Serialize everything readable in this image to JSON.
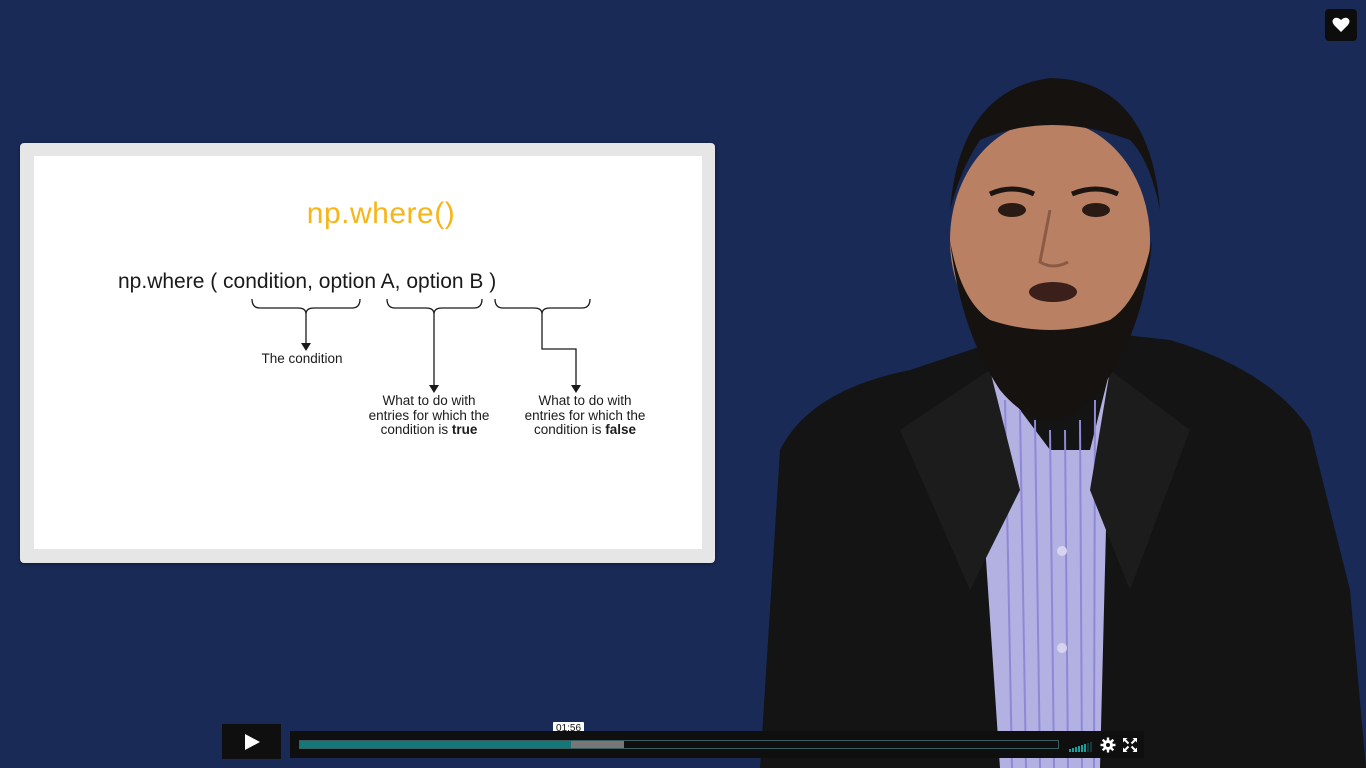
{
  "player": {
    "current_time": "01:56",
    "played_fraction": 0.357,
    "buffered_fraction": 0.427,
    "accent_color": "#13787a",
    "background_color": "#182a55"
  },
  "slide": {
    "title": "np.where()",
    "syntax": "np.where ( condition, option A, option B )",
    "annotation_condition": "The condition",
    "annotation_a_line1": "What to do with",
    "annotation_a_line2": "entries for which the",
    "annotation_a_line3_prefix": "condition is ",
    "annotation_a_bold": "true",
    "annotation_b_line1": "What to do with",
    "annotation_b_line2": "entries for which the",
    "annotation_b_line3_prefix": "condition is ",
    "annotation_b_bold": "false",
    "title_color": "#f6b61a"
  },
  "icons": {
    "like": "heart-icon",
    "play": "play-icon",
    "settings": "gear-icon",
    "fullscreen": "fullscreen-icon",
    "volume": "volume-bars-icon"
  }
}
